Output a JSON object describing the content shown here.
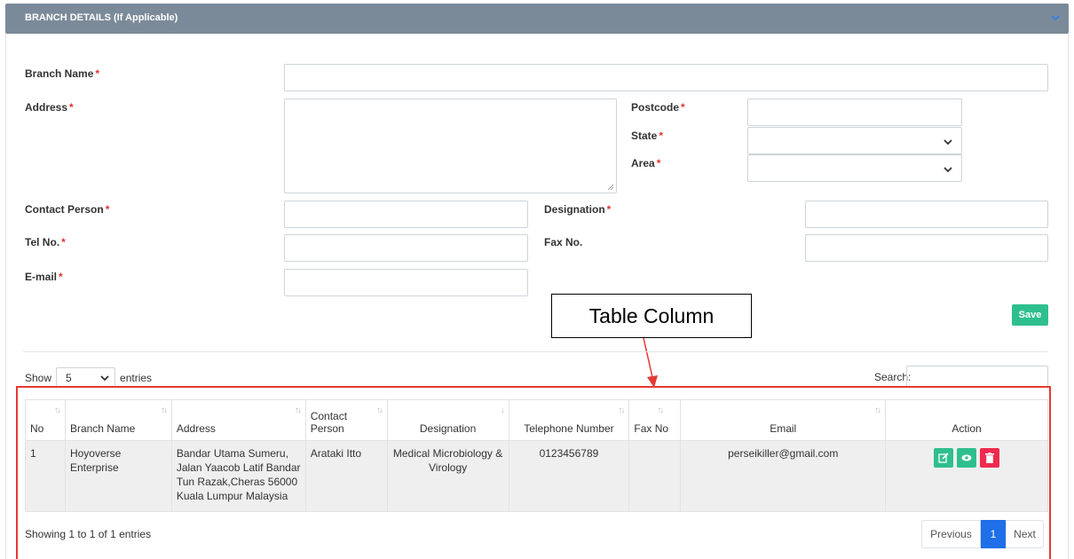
{
  "panel": {
    "title": "BRANCH DETAILS (If Applicable)"
  },
  "form": {
    "branch_name_label": "Branch Name",
    "address_label": "Address",
    "postcode_label": "Postcode",
    "state_label": "State",
    "area_label": "Area",
    "contact_person_label": "Contact Person",
    "designation_label": "Designation",
    "tel_label": "Tel No.",
    "fax_label": "Fax No.",
    "email_label": "E-mail",
    "required_mark": "*",
    "save_label": "Save"
  },
  "annotation": {
    "callout": "Table Column"
  },
  "table_controls": {
    "show_label": "Show",
    "page_length": "5",
    "entries_label": "entries",
    "search_label": "Search:"
  },
  "table": {
    "headers": [
      "No",
      "Branch Name",
      "Address",
      "Contact Person",
      "Designation",
      "Telephone Number",
      "Fax No",
      "Email",
      "Action"
    ],
    "rows": [
      {
        "no": "1",
        "branch_name": "Hoyoverse Enterprise",
        "address": "Bandar Utama Sumeru, Jalan Yaacob Latif Bandar Tun Razak,Cheras 56000 Kuala Lumpur Malaysia",
        "contact_person": "Arataki Itto",
        "designation": "Medical Microbiology & Virology",
        "telephone": "0123456789",
        "fax": "",
        "email": "perseikiller@gmail.com"
      }
    ]
  },
  "pagination": {
    "info": "Showing 1 to 1 of 1 entries",
    "previous": "Previous",
    "current": "1",
    "next": "Next"
  },
  "colors": {
    "header_bg": "#7b8a99",
    "save_green": "#2fbf8f",
    "delete_red": "#ef2a4e",
    "page_blue": "#1e6fe8",
    "annotation_red": "#e53935"
  }
}
